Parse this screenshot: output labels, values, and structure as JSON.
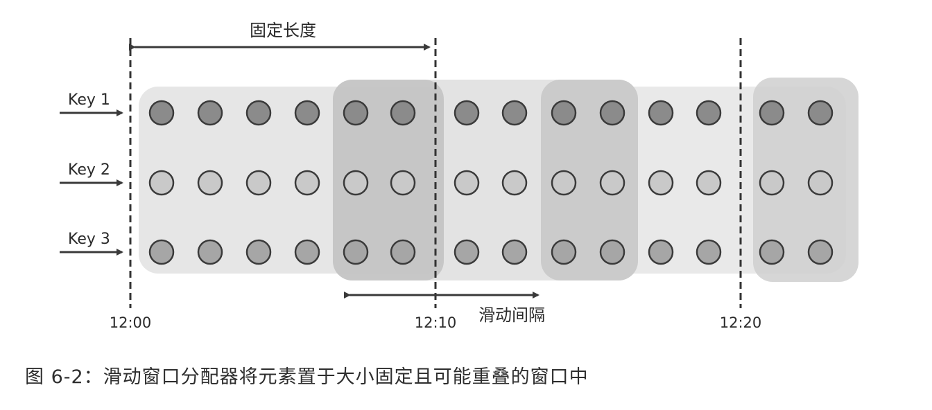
{
  "diagram": {
    "title": "固定长度",
    "slide_label": "滑动间隔",
    "keys": [
      "Key 1",
      "Key 2",
      "Key 3"
    ],
    "times": [
      "12:00",
      "12:10",
      "12:20"
    ],
    "events_per_key": 14,
    "colors": {
      "window_light": "#e3e3e3",
      "window_dark": "#c6c6c6",
      "key1_dot": "#8b8b8b",
      "key2_dot": "#c9c9c9",
      "key3_dot": "#a6a6a6",
      "dot_stroke": "#3a3a3a",
      "arrow": "#3a3a3a"
    }
  },
  "caption": "图 6-2：滑动窗口分配器将元素置于大小固定且可能重叠的窗口中"
}
